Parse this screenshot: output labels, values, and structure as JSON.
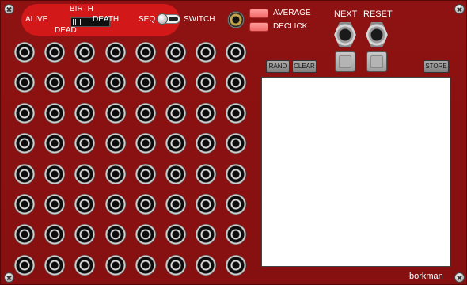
{
  "rule": {
    "birth": "BIRTH",
    "alive": "ALIVE",
    "death": "DEATH",
    "dead": "DEAD"
  },
  "toggle": {
    "seq": "SEQ",
    "switch": "SWITCH"
  },
  "options": {
    "average": "AVERAGE",
    "declick": "DECLICK"
  },
  "transport": {
    "next": "NEXT",
    "reset": "RESET"
  },
  "buttons": {
    "rand": "RAND",
    "clear": "CLEAR",
    "store": "STORE"
  },
  "grid": {
    "rows": 8,
    "cols": 8
  },
  "brand": "borkman",
  "colors": {
    "panel": "#8c1111",
    "rule_block": "#d21818",
    "led": "#f06b6b",
    "display": "#ffffff"
  },
  "icons": {
    "screw": "screw-icon",
    "jack": "jack-socket-icon",
    "gold_jack": "gold-jack-socket-icon"
  }
}
